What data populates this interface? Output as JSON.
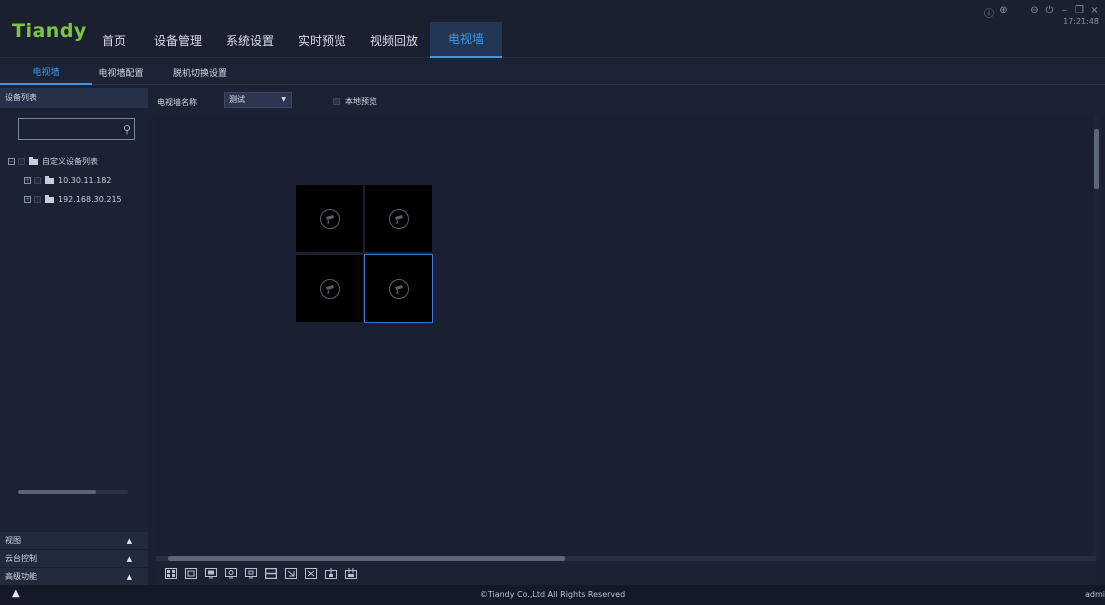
{
  "app": {
    "logo": "Tiandy",
    "clock": "17:21:48",
    "status": {
      "copyright": "©Tiandy Co.,Ltd All Rights Reserved",
      "user": "admi"
    }
  },
  "main_nav": {
    "tabs": [
      {
        "label": "首页"
      },
      {
        "label": "设备管理"
      },
      {
        "label": "系统设置"
      },
      {
        "label": "实时预览"
      },
      {
        "label": "视频回放"
      },
      {
        "label": "电视墙"
      }
    ],
    "active_tab": "电视墙"
  },
  "sub_nav": {
    "tabs": [
      {
        "label": "电视墙"
      },
      {
        "label": "电视墙配置"
      },
      {
        "label": "脱机切换设置"
      }
    ],
    "active_tab": "电视墙"
  },
  "sidebar": {
    "header": "设备列表",
    "search": {
      "value": "",
      "placeholder": ""
    },
    "tree": {
      "root": "自定义设备列表",
      "children": [
        {
          "label": "10.30.11.182"
        },
        {
          "label": "192.168.30.215"
        }
      ]
    },
    "footer": [
      {
        "label": "视图"
      },
      {
        "label": "云台控制"
      },
      {
        "label": "高级功能"
      }
    ]
  },
  "toolbar": {
    "tv_wall_name_label": "电视墙名称",
    "tv_wall_name_value": "测试",
    "local_preview_label": "本地预览",
    "local_preview_checked": false
  },
  "wall": {
    "rows": 2,
    "cols": 2,
    "selected_cell": 4
  },
  "colors": {
    "accent": "#3f97e8",
    "logo": "#7cc442",
    "background": "#1b2133"
  }
}
